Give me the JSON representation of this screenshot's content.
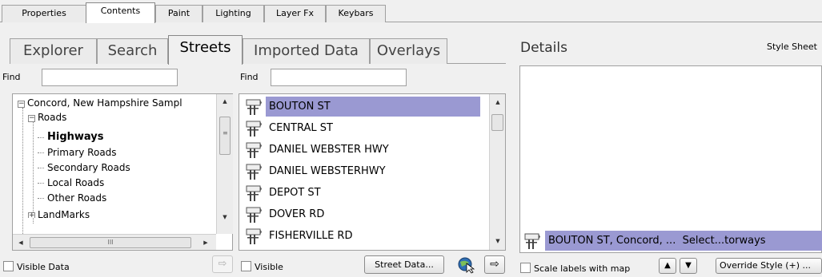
{
  "top_tabs": [
    "Properties",
    "Contents",
    "Paint",
    "Lighting",
    "Layer Fx",
    "Keybars"
  ],
  "active_top_tab": "Contents",
  "sub_tabs": [
    "Explorer",
    "Search",
    "Streets",
    "Imported Data",
    "Overlays"
  ],
  "active_sub_tab": "Streets",
  "left_panel": {
    "find_label": "Find",
    "find_value": "",
    "tree": {
      "root": "Concord, New Hampshire Sampl",
      "roads": "Roads",
      "children": [
        "Highways",
        "Primary Roads",
        "Secondary Roads",
        "Local Roads",
        "Other Roads"
      ],
      "selected_child": "Highways",
      "landmarks": "LandMarks"
    },
    "hscroll_thumb_label": "III",
    "visible_data_label": "Visible Data"
  },
  "middle_panel": {
    "find_label": "Find",
    "find_value": "",
    "streets": [
      "BOUTON ST",
      "CENTRAL ST",
      "DANIEL WEBSTER HWY",
      "DANIEL WEBSTERHWY",
      "DEPOT ST",
      "DOVER RD",
      "FISHERVILLE RD"
    ],
    "selected_street": "BOUTON ST",
    "visible_label": "Visible",
    "street_data_button": "Street Data..."
  },
  "details": {
    "title": "Details",
    "style_sheet_label": "Style Sheet",
    "selected_entry": "BOUTON ST, Concord, ...  Select...torways",
    "scale_labels_label": "Scale labels with map",
    "override_style_button": "Override Style (+) ..."
  },
  "colors": {
    "selection": "#9a99d2",
    "window_bg": "#f0f0f0"
  }
}
